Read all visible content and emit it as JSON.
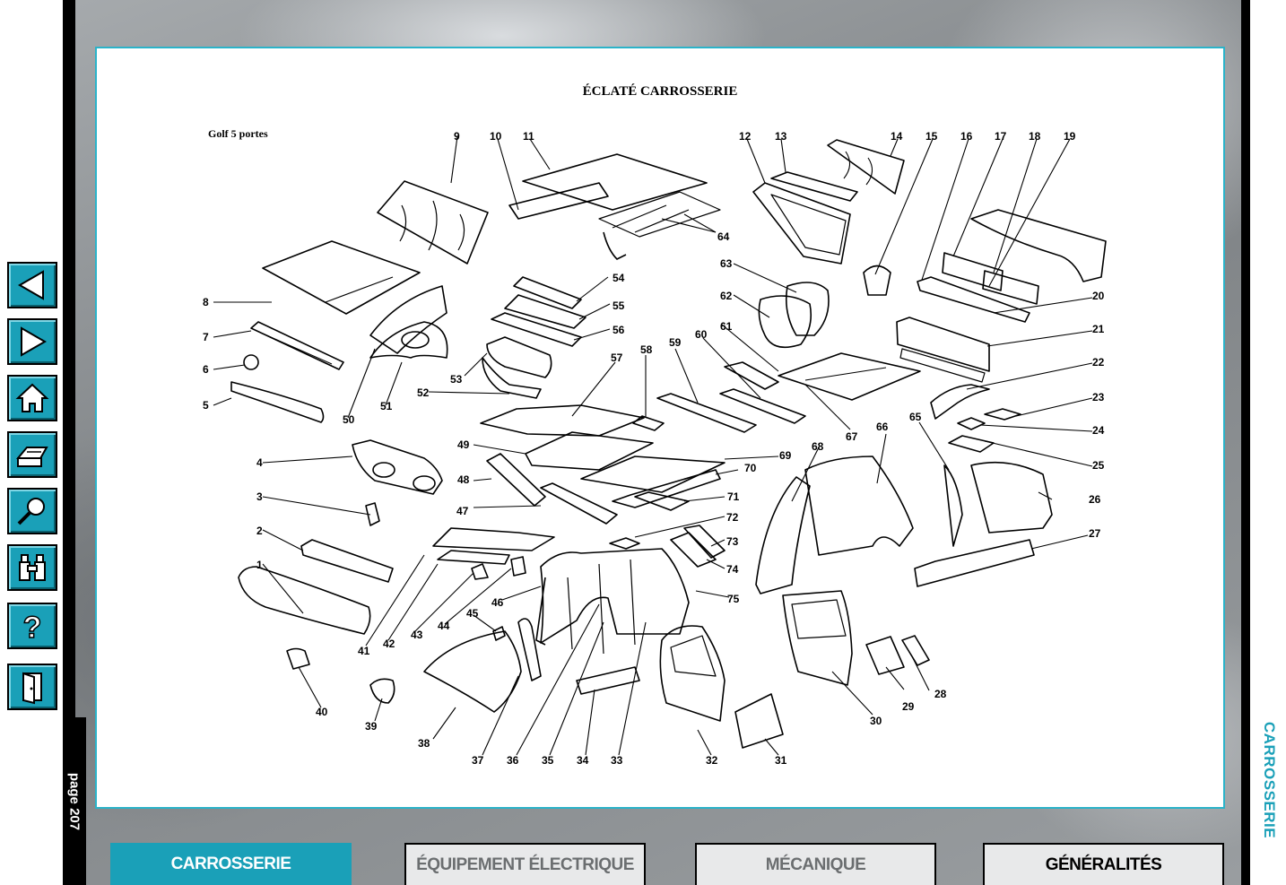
{
  "page": {
    "label": "page 207",
    "section": "CARROSSERIE"
  },
  "diagram": {
    "title": "ÉCLATÉ CARROSSERIE",
    "subtitle": "Golf 5 portes"
  },
  "tabs": [
    {
      "label": "CARROSSERIE",
      "active": true
    },
    {
      "label": "ÉQUIPEMENT ÉLECTRIQUE",
      "active": false
    },
    {
      "label": "MÉCANIQUE",
      "active": false
    },
    {
      "label": "GÉNÉRALITÉS",
      "active": false
    }
  ],
  "nav_icons": [
    "previous-arrow-icon",
    "next-arrow-icon",
    "home-icon",
    "print-icon",
    "search-icon",
    "binoculars-icon",
    "help-icon",
    "exit-door-icon"
  ],
  "colors": {
    "accent": "#1aa0b8",
    "panel_border": "#2bb3c9"
  },
  "labels": {
    "n1": "1",
    "n2": "2",
    "n3": "3",
    "n4": "4",
    "n5": "5",
    "n6": "6",
    "n7": "7",
    "n8": "8",
    "n9": "9",
    "n10": "10",
    "n11": "11",
    "n12": "12",
    "n13": "13",
    "n14": "14",
    "n15": "15",
    "n16": "16",
    "n17": "17",
    "n18": "18",
    "n19": "19",
    "n20": "20",
    "n21": "21",
    "n22": "22",
    "n23": "23",
    "n24": "24",
    "n25": "25",
    "n26": "26",
    "n27": "27",
    "n28": "28",
    "n29": "29",
    "n30": "30",
    "n31": "31",
    "n32": "32",
    "n33": "33",
    "n34": "34",
    "n35": "35",
    "n36": "36",
    "n37": "37",
    "n38": "38",
    "n39": "39",
    "n40": "40",
    "n41": "41",
    "n42": "42",
    "n43": "43",
    "n44": "44",
    "n45": "45",
    "n46": "46",
    "n47": "47",
    "n48": "48",
    "n49": "49",
    "n50": "50",
    "n51": "51",
    "n52": "52",
    "n53": "53",
    "n54": "54",
    "n55": "55",
    "n56": "56",
    "n57": "57",
    "n58": "58",
    "n59": "59",
    "n60": "60",
    "n61": "61",
    "n62": "62",
    "n63": "63",
    "n64": "64",
    "n65": "65",
    "n66": "66",
    "n67": "67",
    "n68": "68",
    "n69": "69",
    "n70": "70",
    "n71": "71",
    "n72": "72",
    "n73": "73",
    "n74": "74",
    "n75": "75"
  }
}
